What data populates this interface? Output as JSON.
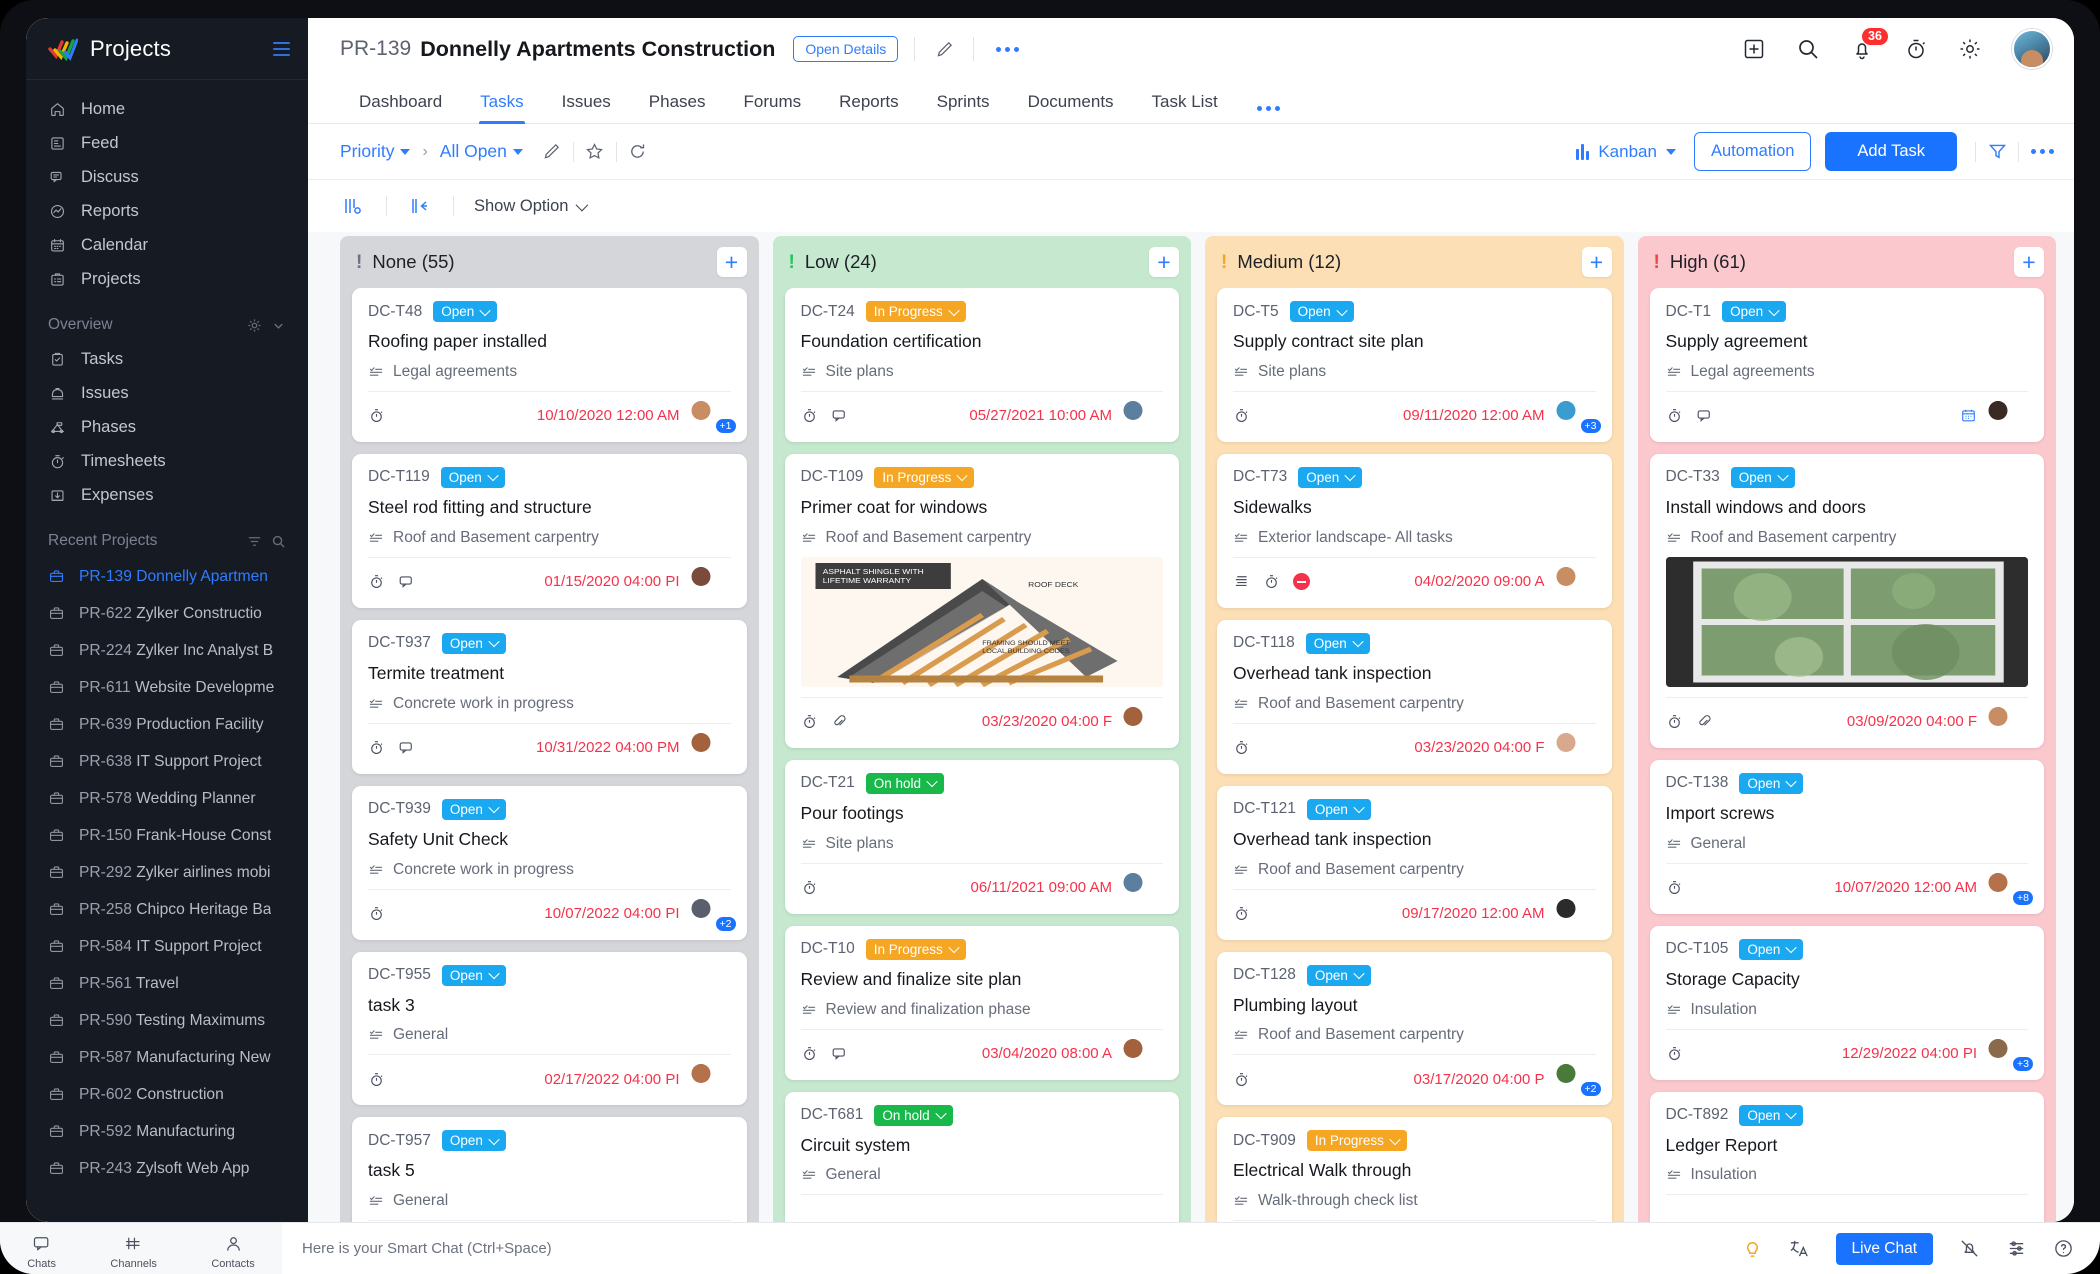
{
  "sidebar": {
    "app_name": "Projects",
    "nav": [
      {
        "label": "Home",
        "icon": "home-icon"
      },
      {
        "label": "Feed",
        "icon": "feed-icon"
      },
      {
        "label": "Discuss",
        "icon": "discuss-icon"
      },
      {
        "label": "Reports",
        "icon": "reports-icon"
      },
      {
        "label": "Calendar",
        "icon": "calendar-icon"
      },
      {
        "label": "Projects",
        "icon": "projects-icon"
      }
    ],
    "overview_label": "Overview",
    "overview": [
      {
        "label": "Tasks",
        "icon": "tasks-icon"
      },
      {
        "label": "Issues",
        "icon": "issues-icon"
      },
      {
        "label": "Phases",
        "icon": "phases-icon"
      },
      {
        "label": "Timesheets",
        "icon": "timesheets-icon"
      },
      {
        "label": "Expenses",
        "icon": "expenses-icon"
      }
    ],
    "recent_label": "Recent Projects",
    "recent": [
      {
        "id": "PR-139",
        "name": "Donnelly Apartmen",
        "active": true
      },
      {
        "id": "PR-622",
        "name": "Zylker Constructio",
        "active": false
      },
      {
        "id": "PR-224",
        "name": "Zylker Inc Analyst B",
        "active": false
      },
      {
        "id": "PR-611",
        "name": "Website Developme",
        "active": false
      },
      {
        "id": "PR-639",
        "name": "Production Facility",
        "active": false
      },
      {
        "id": "PR-638",
        "name": "IT Support Project",
        "active": false
      },
      {
        "id": "PR-578",
        "name": "Wedding Planner",
        "active": false
      },
      {
        "id": "PR-150",
        "name": "Frank-House Const",
        "active": false
      },
      {
        "id": "PR-292",
        "name": "Zylker airlines mobi",
        "active": false
      },
      {
        "id": "PR-258",
        "name": "Chipco Heritage Ba",
        "active": false
      },
      {
        "id": "PR-584",
        "name": "IT Support Project",
        "active": false
      },
      {
        "id": "PR-561",
        "name": "Travel",
        "active": false
      },
      {
        "id": "PR-590",
        "name": "Testing Maximums",
        "active": false
      },
      {
        "id": "PR-587",
        "name": "Manufacturing New",
        "active": false
      },
      {
        "id": "PR-602",
        "name": "Construction",
        "active": false
      },
      {
        "id": "PR-592",
        "name": "Manufacturing",
        "active": false
      },
      {
        "id": "PR-243",
        "name": "Zylsoft Web App",
        "active": false
      }
    ]
  },
  "header": {
    "project_code": "PR-139",
    "project_name": "Donnelly Apartments Construction",
    "open_details": "Open Details",
    "notification_count": "36"
  },
  "tabs": [
    {
      "label": "Dashboard",
      "active": false
    },
    {
      "label": "Tasks",
      "active": true
    },
    {
      "label": "Issues",
      "active": false
    },
    {
      "label": "Phases",
      "active": false
    },
    {
      "label": "Forums",
      "active": false
    },
    {
      "label": "Reports",
      "active": false
    },
    {
      "label": "Sprints",
      "active": false
    },
    {
      "label": "Documents",
      "active": false
    },
    {
      "label": "Task List",
      "active": false
    }
  ],
  "filterbar": {
    "group_by": "Priority",
    "view_filter": "All Open",
    "view_mode": "Kanban",
    "automation": "Automation",
    "add_task": "Add Task"
  },
  "optionbar": {
    "show_option": "Show Option"
  },
  "colors": {
    "accent": "#1a73ff",
    "link": "#2f7dff",
    "overdue": "#f5324b",
    "status_open": "#1aa9f0",
    "status_in_progress": "#f5a623",
    "status_on_hold": "#19b84a",
    "col_none": "#d4d6d9",
    "col_low": "#c5e8ce",
    "col_medium": "#fcdfb4",
    "col_high": "#fbc8ce"
  },
  "columns": [
    {
      "title": "None (55)",
      "bang_color": "#6b7280",
      "bg": "#d4d6d9",
      "cards": [
        {
          "id": "DC-T48",
          "status": "Open",
          "status_type": "open",
          "title": "Roofing paper installed",
          "sub": "Legal agreements",
          "icons": [
            "timer"
          ],
          "date": "10/10/2020 12:00 AM",
          "avatar": "#c98d63",
          "extra": "+1"
        },
        {
          "id": "DC-T119",
          "status": "Open",
          "status_type": "open",
          "title": "Steel rod fitting and structure",
          "sub": "Roof and Basement carpentry",
          "icons": [
            "timer",
            "comment"
          ],
          "date": "01/15/2020 04:00 PI",
          "avatar": "#7a4a3a",
          "extra": ""
        },
        {
          "id": "DC-T937",
          "status": "Open",
          "status_type": "open",
          "title": "Termite treatment",
          "sub": "Concrete work in progress",
          "icons": [
            "timer",
            "comment"
          ],
          "date": "10/31/2022 04:00 PM",
          "avatar": "#a2623c",
          "extra": ""
        },
        {
          "id": "DC-T939",
          "status": "Open",
          "status_type": "open",
          "title": "Safety Unit Check",
          "sub": "Concrete work in progress",
          "icons": [
            "timer"
          ],
          "date": "10/07/2022 04:00 PI",
          "avatar": "#5a5f6b",
          "extra": "+2"
        },
        {
          "id": "DC-T955",
          "status": "Open",
          "status_type": "open",
          "title": "task 3",
          "sub": "General",
          "icons": [
            "timer"
          ],
          "date": "02/17/2022 04:00 PI",
          "avatar": "#b5714a",
          "extra": ""
        },
        {
          "id": "DC-T957",
          "status": "Open",
          "status_type": "open",
          "title": "task 5",
          "sub": "General",
          "icons": [],
          "date": "",
          "avatar": "",
          "extra": ""
        }
      ]
    },
    {
      "title": "Low (24)",
      "bang_color": "#22c55e",
      "bg": "#c5e8ce",
      "cards": [
        {
          "id": "DC-T24",
          "status": "In Progress",
          "status_type": "progress",
          "title": "Foundation certification",
          "sub": "Site plans",
          "icons": [
            "timer",
            "comment"
          ],
          "date": "05/27/2021 10:00 AM",
          "avatar": "#5c7fa0",
          "extra": ""
        },
        {
          "id": "DC-T109",
          "status": "In Progress",
          "status_type": "progress",
          "title": "Primer coat for windows",
          "sub": "Roof and Basement carpentry",
          "image": "roof-diagram",
          "icons": [
            "timer",
            "attachment"
          ],
          "date": "03/23/2020 04:00 F",
          "avatar": "#a2623c",
          "extra": ""
        },
        {
          "id": "DC-T21",
          "status": "On hold",
          "status_type": "hold",
          "title": "Pour footings",
          "sub": "Site plans",
          "icons": [
            "timer"
          ],
          "date": "06/11/2021 09:00 AM",
          "avatar": "#5c7fa0",
          "extra": ""
        },
        {
          "id": "DC-T10",
          "status": "In Progress",
          "status_type": "progress",
          "title": "Review and finalize site plan",
          "sub": "Review and finalization phase",
          "icons": [
            "timer",
            "comment"
          ],
          "date": "03/04/2020 08:00 A",
          "avatar": "#a2623c",
          "extra": ""
        },
        {
          "id": "DC-T681",
          "status": "On hold",
          "status_type": "hold",
          "title": "Circuit system",
          "sub": "General",
          "icons": [],
          "date": "",
          "avatar": "",
          "extra": ""
        }
      ]
    },
    {
      "title": "Medium (12)",
      "bang_color": "#f5a623",
      "bg": "#fcdfb4",
      "cards": [
        {
          "id": "DC-T5",
          "status": "Open",
          "status_type": "open",
          "title": "Supply contract site plan",
          "sub": "Site plans",
          "icons": [
            "timer"
          ],
          "date": "09/11/2020 12:00 AM",
          "avatar": "#3b9ccf",
          "extra": "+3"
        },
        {
          "id": "DC-T73",
          "status": "Open",
          "status_type": "open",
          "title": "Sidewalks",
          "sub": "Exterior landscape- All tasks",
          "icons": [
            "list",
            "timer",
            "blocked"
          ],
          "date": "04/02/2020 09:00 A",
          "avatar": "#c98d63",
          "extra": ""
        },
        {
          "id": "DC-T118",
          "status": "Open",
          "status_type": "open",
          "title": "Overhead tank inspection",
          "sub": "Roof and Basement carpentry",
          "icons": [
            "timer"
          ],
          "date": "03/23/2020 04:00 F",
          "avatar": "#d8a98c",
          "extra": ""
        },
        {
          "id": "DC-T121",
          "status": "Open",
          "status_type": "open",
          "title": "Overhead tank inspection",
          "sub": "Roof and Basement carpentry",
          "icons": [
            "timer"
          ],
          "date": "09/17/2020 12:00 AM",
          "avatar": "#2b2b2b",
          "extra": ""
        },
        {
          "id": "DC-T128",
          "status": "Open",
          "status_type": "open",
          "title": "Plumbing layout",
          "sub": "Roof and Basement carpentry",
          "icons": [
            "timer"
          ],
          "date": "03/17/2020 04:00 P",
          "avatar": "#4a7a3a",
          "extra": "+2"
        },
        {
          "id": "DC-T909",
          "status": "In Progress",
          "status_type": "progress",
          "title": "Electrical Walk through",
          "sub": "Walk-through check list",
          "icons": [],
          "date": "",
          "avatar": "",
          "extra": ""
        }
      ]
    },
    {
      "title": "High (61)",
      "bang_color": "#ef4444",
      "bg": "#fbc8ce",
      "cards": [
        {
          "id": "DC-T1",
          "status": "Open",
          "status_type": "open",
          "title": "Supply agreement",
          "sub": "Legal agreements",
          "icons": [
            "timer",
            "comment"
          ],
          "date": "",
          "avatar": "#3a2a24",
          "extra": "",
          "trailing_icon": "calendar"
        },
        {
          "id": "DC-T33",
          "status": "Open",
          "status_type": "open",
          "title": "Install windows and doors",
          "sub": "Roof and Basement carpentry",
          "image": "window-photo",
          "icons": [
            "timer",
            "attachment"
          ],
          "date": "03/09/2020 04:00 F",
          "avatar": "#c98d63",
          "extra": ""
        },
        {
          "id": "DC-T138",
          "status": "Open",
          "status_type": "open",
          "title": "Import screws",
          "sub": "General",
          "icons": [
            "timer"
          ],
          "date": "10/07/2020 12:00 AM",
          "avatar": "#b5714a",
          "extra": "+8"
        },
        {
          "id": "DC-T105",
          "status": "Open",
          "status_type": "open",
          "title": "Storage Capacity",
          "sub": "Insulation",
          "icons": [
            "timer"
          ],
          "date": "12/29/2022 04:00 PI",
          "avatar": "#8a6a4a",
          "extra": "+3"
        },
        {
          "id": "DC-T892",
          "status": "Open",
          "status_type": "open",
          "title": "Ledger Report",
          "sub": "Insulation",
          "icons": [],
          "date": "",
          "avatar": "",
          "extra": ""
        }
      ]
    }
  ],
  "dock": {
    "items": [
      {
        "label": "Chats",
        "icon": "chat-icon"
      },
      {
        "label": "Channels",
        "icon": "channels-icon"
      },
      {
        "label": "Contacts",
        "icon": "contacts-icon"
      }
    ],
    "message": "Here is your Smart Chat (Ctrl+Space)",
    "live_chat": "Live Chat"
  }
}
